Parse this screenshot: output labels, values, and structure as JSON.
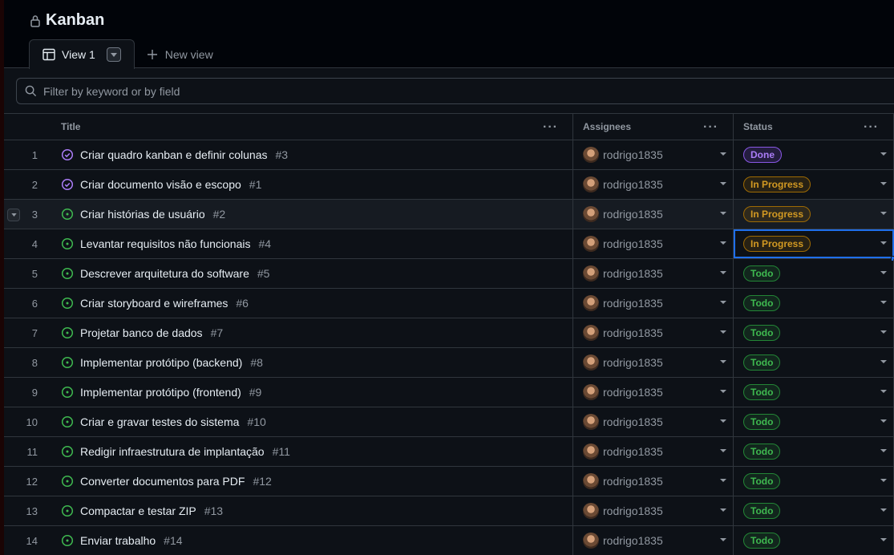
{
  "project": {
    "title": "Kanban"
  },
  "tabs": [
    {
      "label": "View 1"
    }
  ],
  "new_view_label": "New view",
  "filter": {
    "placeholder": "Filter by keyword or by field"
  },
  "columns": {
    "title": "Title",
    "assignees": "Assignees",
    "status": "Status"
  },
  "colors": {
    "done": "#ab7df8",
    "in_progress": "#d29922",
    "todo": "#3fb950",
    "accent": "#1f6feb"
  },
  "rows": [
    {
      "num": "1",
      "title": "Criar quadro kanban e definir colunas",
      "issue": "#3",
      "assignee": "rodrigo1835",
      "status": "Done",
      "icon": "closed-issue-icon"
    },
    {
      "num": "2",
      "title": "Criar documento visão e escopo",
      "issue": "#1",
      "assignee": "rodrigo1835",
      "status": "In Progress",
      "icon": "closed-issue-icon"
    },
    {
      "num": "3",
      "title": "Criar histórias de usuário",
      "issue": "#2",
      "assignee": "rodrigo1835",
      "status": "In Progress",
      "icon": "open-issue-icon"
    },
    {
      "num": "4",
      "title": "Levantar requisitos não funcionais",
      "issue": "#4",
      "assignee": "rodrigo1835",
      "status": "In Progress",
      "icon": "open-issue-icon"
    },
    {
      "num": "5",
      "title": "Descrever arquitetura do software",
      "issue": "#5",
      "assignee": "rodrigo1835",
      "status": "Todo",
      "icon": "open-issue-icon"
    },
    {
      "num": "6",
      "title": "Criar storyboard e wireframes",
      "issue": "#6",
      "assignee": "rodrigo1835",
      "status": "Todo",
      "icon": "open-issue-icon"
    },
    {
      "num": "7",
      "title": "Projetar banco de dados",
      "issue": "#7",
      "assignee": "rodrigo1835",
      "status": "Todo",
      "icon": "open-issue-icon"
    },
    {
      "num": "8",
      "title": "Implementar protótipo (backend)",
      "issue": "#8",
      "assignee": "rodrigo1835",
      "status": "Todo",
      "icon": "open-issue-icon"
    },
    {
      "num": "9",
      "title": "Implementar protótipo (frontend)",
      "issue": "#9",
      "assignee": "rodrigo1835",
      "status": "Todo",
      "icon": "open-issue-icon"
    },
    {
      "num": "10",
      "title": "Criar e gravar testes do sistema",
      "issue": "#10",
      "assignee": "rodrigo1835",
      "status": "Todo",
      "icon": "open-issue-icon"
    },
    {
      "num": "11",
      "title": "Redigir infraestrutura de implantação",
      "issue": "#11",
      "assignee": "rodrigo1835",
      "status": "Todo",
      "icon": "open-issue-icon"
    },
    {
      "num": "12",
      "title": "Converter documentos para PDF",
      "issue": "#12",
      "assignee": "rodrigo1835",
      "status": "Todo",
      "icon": "open-issue-icon"
    },
    {
      "num": "13",
      "title": "Compactar e testar ZIP",
      "issue": "#13",
      "assignee": "rodrigo1835",
      "status": "Todo",
      "icon": "open-issue-icon"
    },
    {
      "num": "14",
      "title": "Enviar trabalho",
      "issue": "#14",
      "assignee": "rodrigo1835",
      "status": "Todo",
      "icon": "open-issue-icon"
    }
  ]
}
